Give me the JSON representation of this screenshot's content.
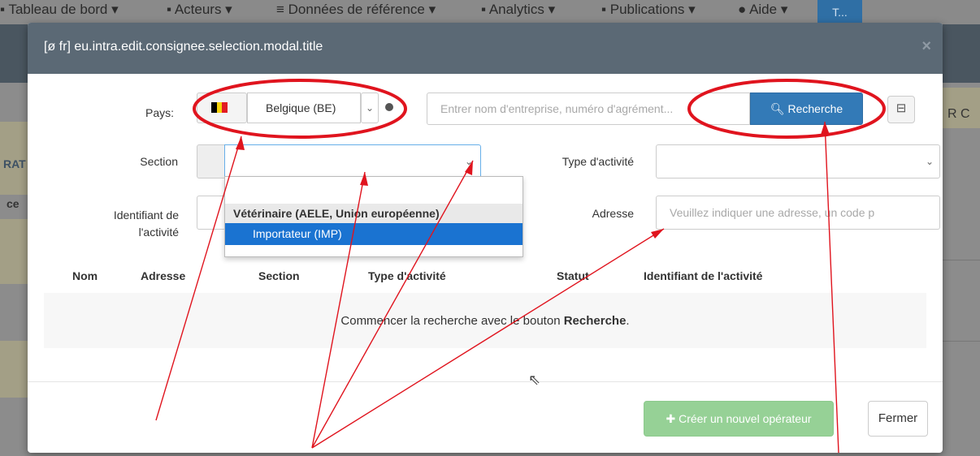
{
  "background_nav": {
    "items": [
      {
        "icon": "dashboard-icon",
        "label": "Tableau de bord"
      },
      {
        "icon": "actors-icon",
        "label": "Acteurs"
      },
      {
        "icon": "database-icon",
        "label": "Données de référence"
      },
      {
        "icon": "chart-icon",
        "label": "Analytics"
      },
      {
        "icon": "publications-icon",
        "label": "Publications"
      },
      {
        "icon": "help-icon",
        "label": "Aide"
      }
    ],
    "user_label": "T..."
  },
  "background_page": {
    "left_fragment_1": "RAT",
    "left_fragment_2": "ce",
    "right_fragment": "R C"
  },
  "modal": {
    "title": "[ø fr] eu.intra.edit.consignee.selection.modal.title",
    "close_icon": "×",
    "country_label": "Pays:",
    "country_value": "Belgique (BE)",
    "flag_colors": [
      "#000000",
      "#f5d20a",
      "#e21b23"
    ],
    "search_placeholder": "Entrer nom d'entreprise, numéro d'agrément...",
    "search_button": "Recherche",
    "search_icon": "search-icon",
    "collapse_icon": "⊟",
    "section_label": "Section",
    "activity_type_label": "Type d'activité",
    "activity_id_label_1": "Identifiant de",
    "activity_id_label_2": "l'activité",
    "address_label": "Adresse",
    "address_placeholder": "Veuillez indiquer une adresse, un code p",
    "dropdown": {
      "group": "Vétérinaire (AELE, Union européenne)",
      "option": "Importateur (IMP)"
    },
    "table_headers": [
      "Nom",
      "Adresse",
      "Section",
      "Type d'activité",
      "Statut",
      "Identifiant de l'activité"
    ],
    "empty_text_prefix": "Commencer la recherche avec le bouton ",
    "empty_text_bold": "Recherche",
    "empty_text_suffix": ".",
    "create_button": "Créer un nouvel opérateur",
    "close_button": "Fermer"
  },
  "annotation_color": "#e0141e"
}
